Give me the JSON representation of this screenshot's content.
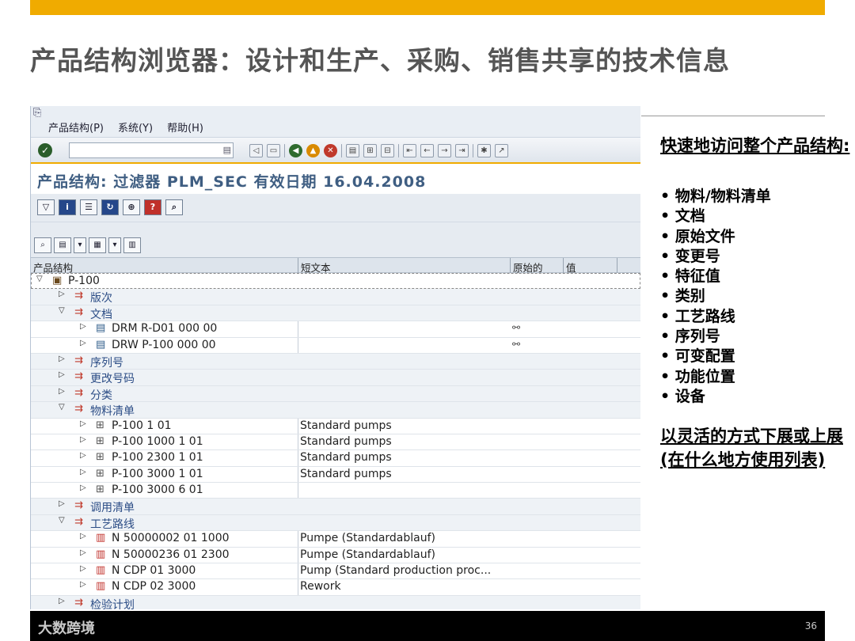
{
  "slide": {
    "title": "产品结构浏览器：设计和生产、采购、销售共享的技术信息",
    "page_number": "36",
    "watermark": "大数跨境"
  },
  "sap": {
    "menu": [
      "产品结构(P)",
      "系统(Y)",
      "帮助(H)"
    ],
    "screen_title": "产品结构: 过滤器 PLM_SEC 有效日期 16.04.2008",
    "columns": [
      "产品结构",
      "短文本",
      "原始的",
      "值"
    ],
    "rows": [
      {
        "label": "P-100",
        "indent": 0,
        "expanded": true,
        "icon": "folder-icon",
        "text": "",
        "orig": ""
      },
      {
        "label": "版次",
        "indent": 1,
        "expanded": false,
        "icon": "link-icon",
        "text": "",
        "orig": ""
      },
      {
        "label": "文档",
        "indent": 1,
        "expanded": true,
        "icon": "link-icon",
        "text": "",
        "orig": ""
      },
      {
        "label": "DRM R-D01 000 00",
        "indent": 2,
        "expanded": false,
        "icon": "document-icon",
        "text": "",
        "orig": "linked"
      },
      {
        "label": "DRW P-100 000 00",
        "indent": 2,
        "expanded": false,
        "icon": "document-icon",
        "text": "",
        "orig": "linked"
      },
      {
        "label": "序列号",
        "indent": 1,
        "expanded": false,
        "icon": "link-icon",
        "text": "",
        "orig": ""
      },
      {
        "label": "更改号码",
        "indent": 1,
        "expanded": false,
        "icon": "link-icon",
        "text": "",
        "orig": ""
      },
      {
        "label": "分类",
        "indent": 1,
        "expanded": false,
        "icon": "link-icon",
        "text": "",
        "orig": ""
      },
      {
        "label": "物料清单",
        "indent": 1,
        "expanded": true,
        "icon": "link-icon",
        "text": "",
        "orig": ""
      },
      {
        "label": "P-100  1 01",
        "indent": 2,
        "expanded": false,
        "icon": "bom-icon",
        "text": "Standard pumps",
        "orig": ""
      },
      {
        "label": "P-100 1000 1 01",
        "indent": 2,
        "expanded": false,
        "icon": "bom-icon",
        "text": "Standard pumps",
        "orig": ""
      },
      {
        "label": "P-100 2300 1 01",
        "indent": 2,
        "expanded": false,
        "icon": "bom-icon",
        "text": "Standard pumps",
        "orig": ""
      },
      {
        "label": "P-100 3000 1 01",
        "indent": 2,
        "expanded": false,
        "icon": "bom-icon",
        "text": "Standard pumps",
        "orig": ""
      },
      {
        "label": "P-100 3000 6 01",
        "indent": 2,
        "expanded": false,
        "icon": "bom-icon",
        "text": "",
        "orig": ""
      },
      {
        "label": "调用清单",
        "indent": 1,
        "expanded": false,
        "icon": "link-icon",
        "text": "",
        "orig": ""
      },
      {
        "label": "工艺路线",
        "indent": 1,
        "expanded": true,
        "icon": "link-icon",
        "text": "",
        "orig": ""
      },
      {
        "label": "N 50000002 01 1000",
        "indent": 2,
        "expanded": false,
        "icon": "routing-icon",
        "text": "Pumpe (Standardablauf)",
        "orig": ""
      },
      {
        "label": "N 50000236 01 2300",
        "indent": 2,
        "expanded": false,
        "icon": "routing-icon",
        "text": "Pumpe (Standardablauf)",
        "orig": ""
      },
      {
        "label": "N CDP 01 3000",
        "indent": 2,
        "expanded": false,
        "icon": "routing-icon",
        "text": "Pump (Standard production proc...",
        "orig": ""
      },
      {
        "label": "N CDP 02 3000",
        "indent": 2,
        "expanded": false,
        "icon": "routing-icon",
        "text": "Rework",
        "orig": ""
      },
      {
        "label": "检验计划",
        "indent": 1,
        "expanded": false,
        "icon": "link-icon",
        "text": "",
        "orig": ""
      }
    ]
  },
  "panel": {
    "heading1": "快速地访问整个产品结构:",
    "items": [
      "物料/物料清单",
      "文档",
      "原始文件",
      "变更号",
      "特征值",
      "类别",
      "工艺路线",
      "序列号",
      "可变配置",
      "功能位置",
      "设备"
    ],
    "heading2": "以灵活的方式下展或上展 (在什么地方使用列表)"
  },
  "colors": {
    "accent": "#f0ab00",
    "title_gray": "#555555",
    "sap_blue": "#3f5e82"
  }
}
